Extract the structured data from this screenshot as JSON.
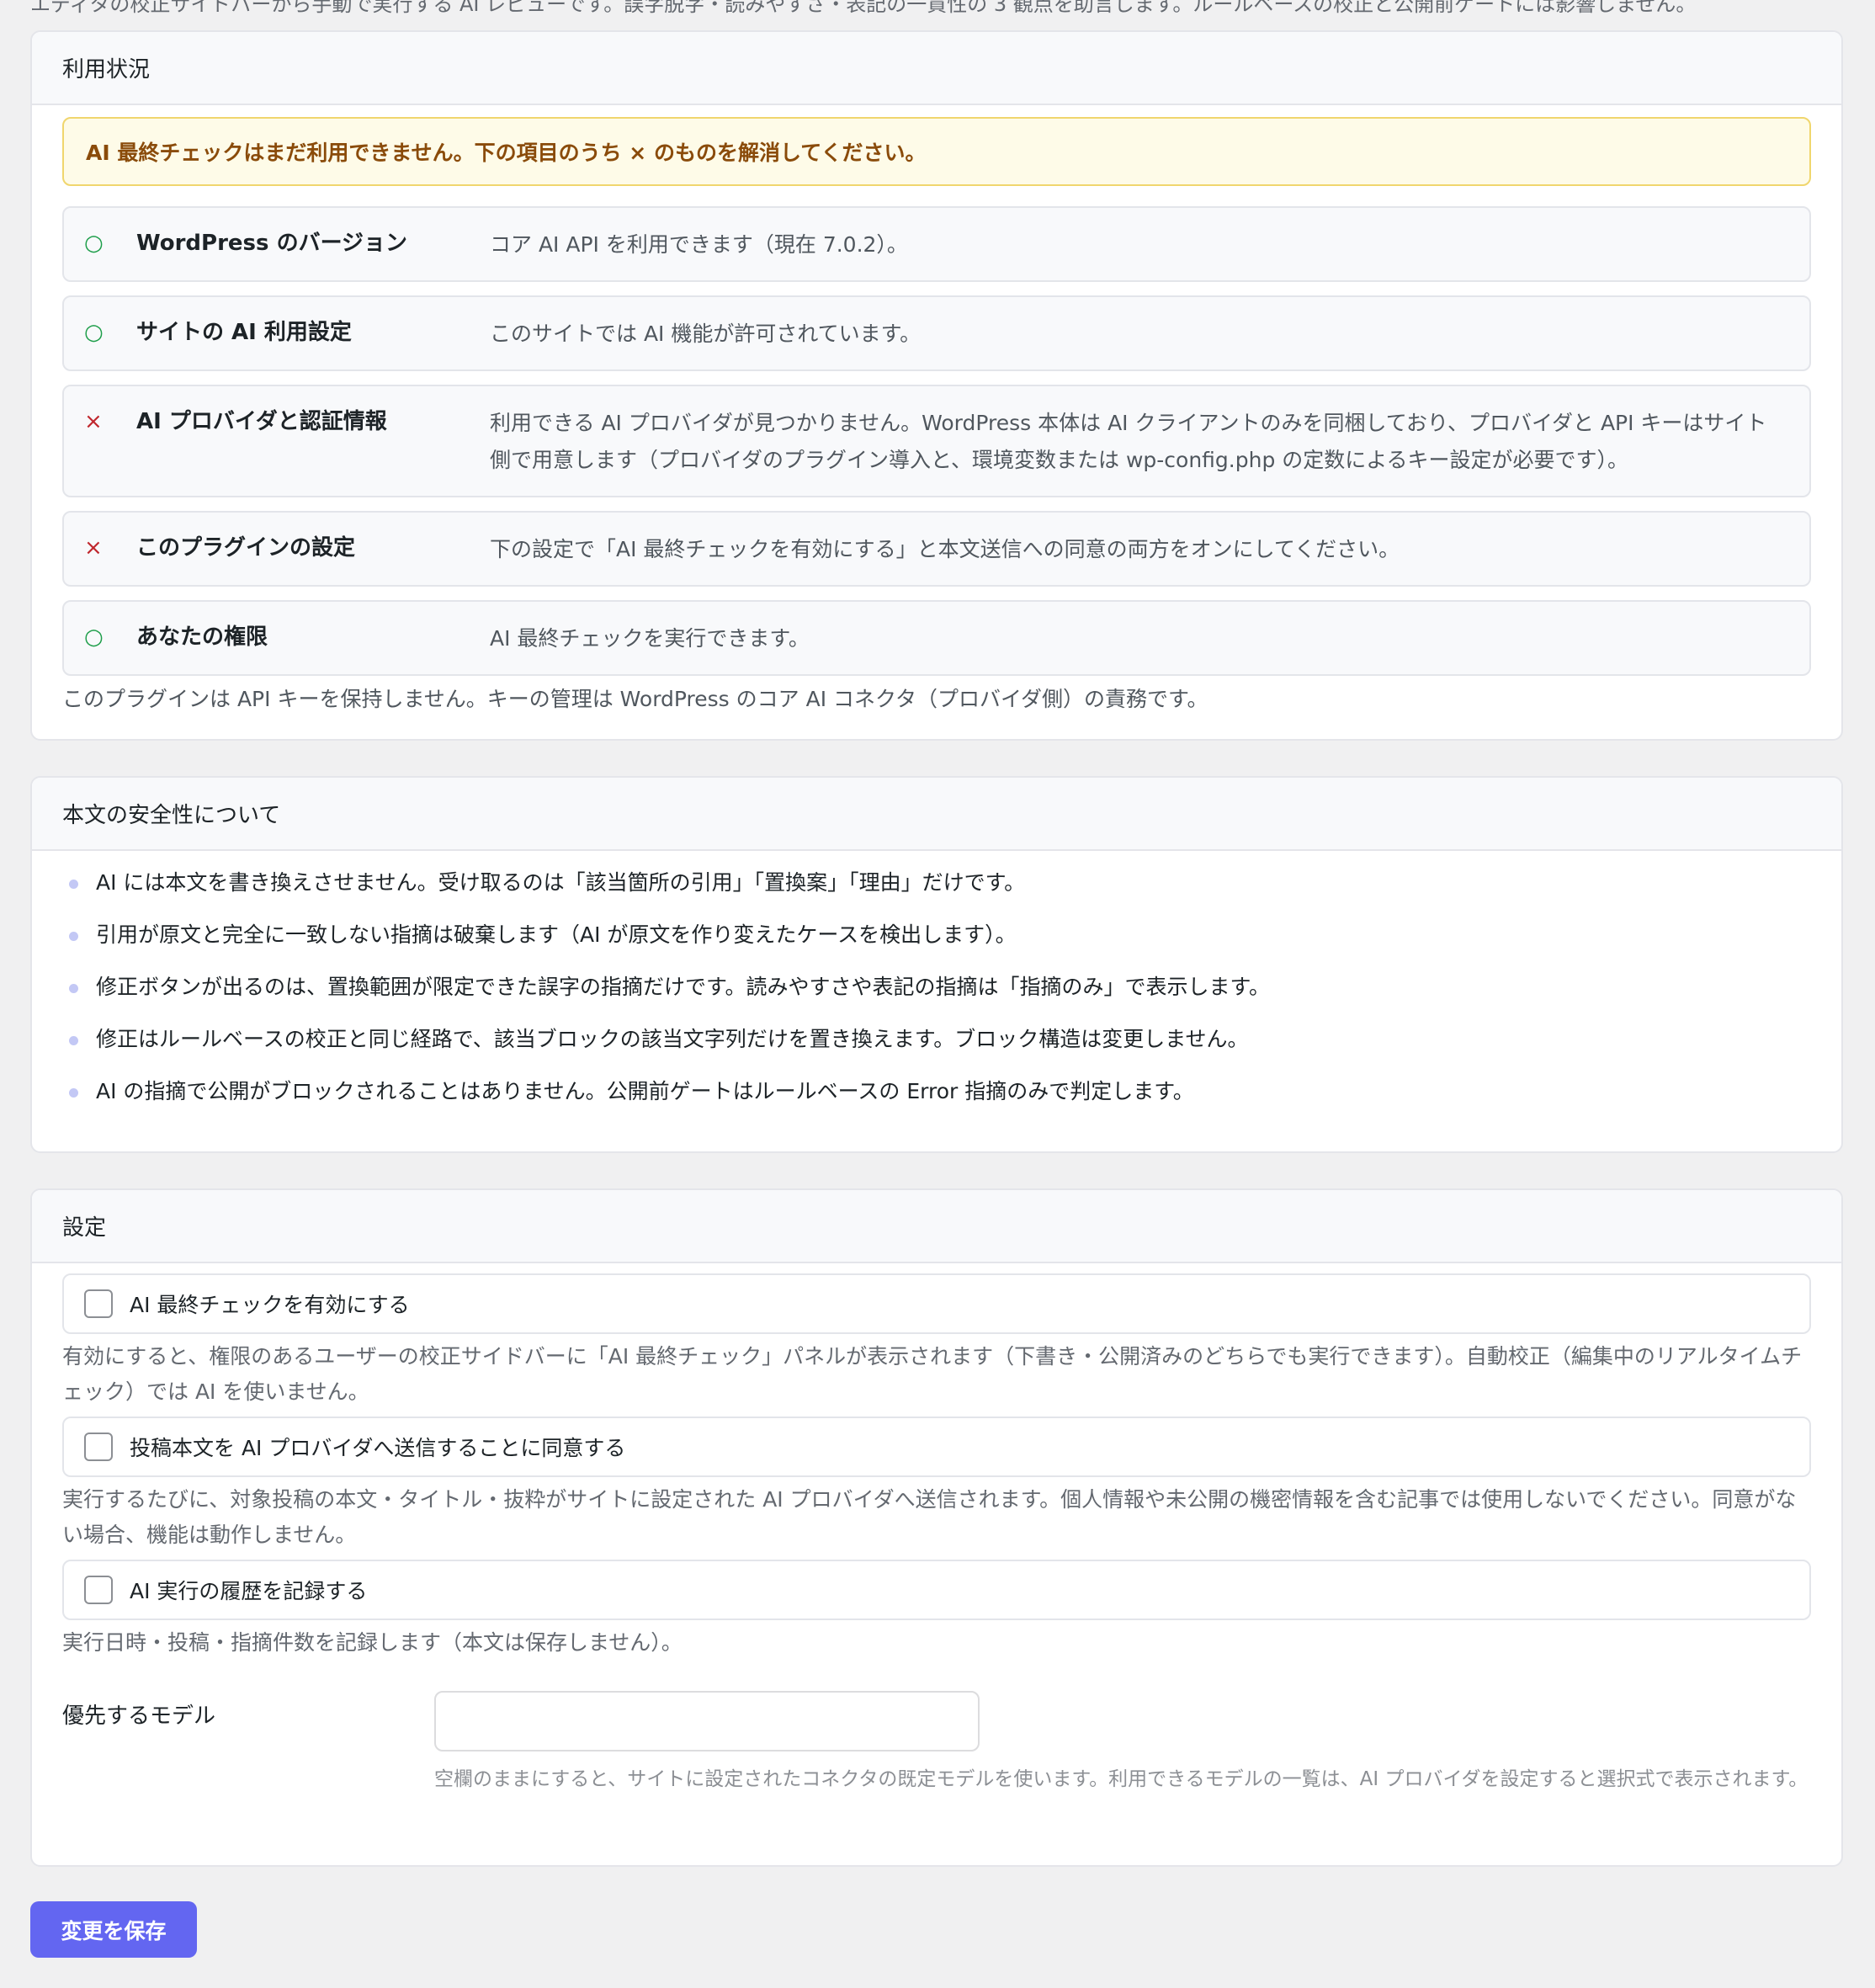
{
  "intro": "エディタの校正サイドバーから手動で実行する AI レビューです。誤字脱字・読みやすさ・表記の一貫性の 3 観点を助言します。ルールベースの校正と公開前ゲートには影響しません。",
  "status": {
    "title": "利用状況",
    "notice": "AI 最終チェックはまだ利用できません。下の項目のうち × のものを解消してください。",
    "rows": [
      {
        "mark": "○",
        "label": "WordPress のバージョン",
        "desc": "コア AI API を利用できます（現在 7.0.2）。"
      },
      {
        "mark": "○",
        "label": "サイトの AI 利用設定",
        "desc": "このサイトでは AI 機能が許可されています。"
      },
      {
        "mark": "×",
        "label": "AI プロバイダと認証情報",
        "desc": "利用できる AI プロバイダが見つかりません。WordPress 本体は AI クライアントのみを同梱しており、プロバイダと API キーはサイト側で用意します（プロバイダのプラグイン導入と、環境変数または wp-config.php の定数によるキー設定が必要です）。"
      },
      {
        "mark": "×",
        "label": "このプラグインの設定",
        "desc": "下の設定で「AI 最終チェックを有効にする」と本文送信への同意の両方をオンにしてください。"
      },
      {
        "mark": "○",
        "label": "あなたの権限",
        "desc": "AI 最終チェックを実行できます。"
      }
    ],
    "note": "このプラグインは API キーを保持しません。キーの管理は WordPress のコア AI コネクタ（プロバイダ側）の責務です。"
  },
  "safety": {
    "title": "本文の安全性について",
    "items": [
      "AI には本文を書き換えさせません。受け取るのは「該当箇所の引用」「置換案」「理由」だけです。",
      "引用が原文と完全に一致しない指摘は破棄します（AI が原文を作り変えたケースを検出します）。",
      "修正ボタンが出るのは、置換範囲が限定できた誤字の指摘だけです。読みやすさや表記の指摘は「指摘のみ」で表示します。",
      "修正はルールベースの校正と同じ経路で、該当ブロックの該当文字列だけを置き換えます。ブロック構造は変更しません。",
      "AI の指摘で公開がブロックされることはありません。公開前ゲートはルールベースの Error 指摘のみで判定します。"
    ]
  },
  "settings": {
    "title": "設定",
    "enable_label": "AI 最終チェックを有効にする",
    "enable_help": "有効にすると、権限のあるユーザーの校正サイドバーに「AI 最終チェック」パネルが表示されます（下書き・公開済みのどちらでも実行できます）。自動校正（編集中のリアルタイムチェック）では AI を使いません。",
    "consent_label": "投稿本文を AI プロバイダへ送信することに同意する",
    "consent_help": "実行するたびに、対象投稿の本文・タイトル・抜粋がサイトに設定された AI プロバイダへ送信されます。個人情報や未公開の機密情報を含む記事では使用しないでください。同意がない場合、機能は動作しません。",
    "log_label": "AI 実行の履歴を記録する",
    "log_help": "実行日時・投稿・指摘件数を記録します（本文は保存しません）。",
    "model_label": "優先するモデル",
    "model_value": "",
    "model_help": "空欄のままにすると、サイトに設定されたコネクタの既定モデルを使います。利用できるモデルの一覧は、AI プロバイダを設定すると選択式で表示されます。"
  },
  "save_label": "変更を保存"
}
